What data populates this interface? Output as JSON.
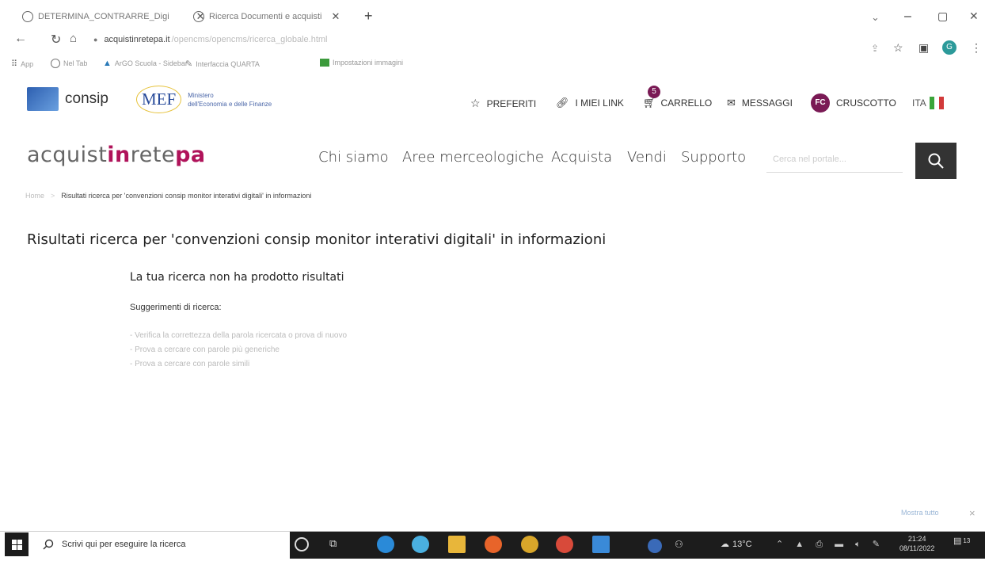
{
  "browser": {
    "tabs": [
      {
        "title": "DETERMINA_CONTRARRE_Digi"
      },
      {
        "title": "Ricerca Documenti e acquisti"
      }
    ],
    "new_tab": "+",
    "address": "acquistinretepa.it",
    "address_path": "/opencms/opencms/ricerca_globale.html",
    "bookmarks": [
      "App",
      "Nel Tab",
      "ArGO Scuola - Sidebar",
      "Interfaccia QUARTA",
      "Impostazioni immagini"
    ],
    "window_controls": {
      "minimize": "–",
      "maximize": "▢",
      "close": "✕",
      "dropdown": "⌄"
    },
    "profile_initial": "G"
  },
  "header": {
    "consip": "consip",
    "mef": "MEF",
    "mef_sub1": "Ministero",
    "mef_sub2": "dell'Economia e delle Finanze",
    "preferiti": "PREFERITI",
    "miei_link": "I MIEI LINK",
    "carrello": "CARRELLO",
    "carrello_count": "5",
    "messaggi": "MESSAGGI",
    "user_initials": "FC",
    "cruscotto": "CRUSCOTTO",
    "lang": "ITA"
  },
  "logo": {
    "part1": "acquist",
    "part2": "in",
    "part3": "rete",
    "part4": "pa"
  },
  "nav": {
    "items": [
      "Chi siamo",
      "Aree merceologiche",
      "Acquista",
      "Vendi",
      "Supporto"
    ],
    "search_placeholder": "Cerca nel portale..."
  },
  "breadcrumb": {
    "home": "Home",
    "separator": ">",
    "current": "Risultati ricerca per 'convenzioni consip monitor interativi digitali' in informazioni"
  },
  "main": {
    "title": "Risultati ricerca per 'convenzioni consip monitor interativi digitali' in informazioni",
    "no_results": "La tua ricerca non ha prodotto risultati",
    "suggestions_label": "Suggerimenti di ricerca:",
    "suggestions": [
      "- Verifica la correttezza della parola ricercata o prova di nuovo",
      "- Prova a cercare con parole più generiche",
      "- Prova a cercare con parole simili"
    ]
  },
  "notice": {
    "text": "Mostra tutto",
    "close": "×"
  },
  "taskbar": {
    "search_placeholder": "Scrivi qui per eseguire la ricerca",
    "weather": "13°C",
    "time": "21:24",
    "date": "08/11/2022",
    "notifications": "13"
  },
  "colors": {
    "accent_pink": "#b0135a",
    "fc_purple": "#7a1a55",
    "search_btn": "#333333",
    "taskbar": "#1c1c1c"
  }
}
